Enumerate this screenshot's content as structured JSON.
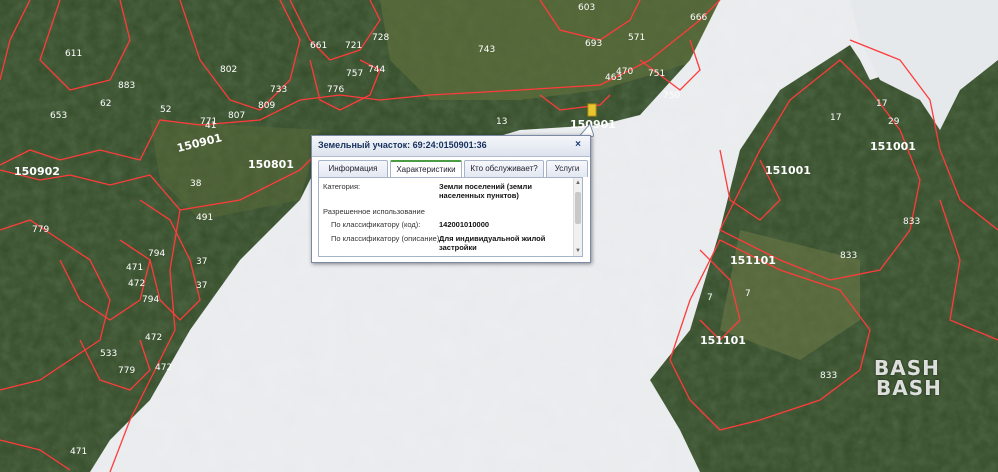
{
  "popup": {
    "title": "Земельный участок: 69:24:0150901:36",
    "close_glyph": "×",
    "tabs": [
      {
        "label": "Информация"
      },
      {
        "label": "Характеристики"
      },
      {
        "label": "Кто обслуживает?"
      },
      {
        "label": "Услуги"
      }
    ],
    "active_tab": "Характеристики",
    "fields": {
      "category_label": "Категория:",
      "category_value_1": "Земли поселений (земли",
      "category_value_2": "населенных пунктов)",
      "permitted_use_heading": "Разрешенное использование",
      "classifier_code_label": "По классификатору (код):",
      "classifier_code_value": "142001010000",
      "classifier_desc_label": "По классификатору (описание):",
      "classifier_desc_value_1": "Для индивидуальной жилой",
      "classifier_desc_value_2": "застройки"
    }
  },
  "map": {
    "plot_labels_big": [
      "150902",
      "150901",
      "150801",
      "150901",
      "151001",
      "151001",
      "151101",
      "151101"
    ],
    "plot_labels_small": [
      "62",
      "611",
      "883",
      "802",
      "807",
      "809",
      "771",
      "733",
      "661",
      "721",
      "728",
      "776",
      "757",
      "744",
      "603",
      "653",
      "470",
      "693",
      "463",
      "571",
      "751",
      "743",
      "750",
      "666",
      "17",
      "17",
      "29",
      "37",
      "491",
      "38",
      "7",
      "7",
      "833",
      "833",
      "533",
      "472",
      "779",
      "471",
      "472",
      "779",
      "472",
      "794",
      "794",
      "471",
      "52",
      "41",
      "13"
    ]
  },
  "watermark": {
    "line1": "BASH",
    "line2": "BASH"
  },
  "colors": {
    "parcel_line": "#ff3b3b",
    "water": "#eef0f1",
    "forest": "#2f4a26"
  }
}
